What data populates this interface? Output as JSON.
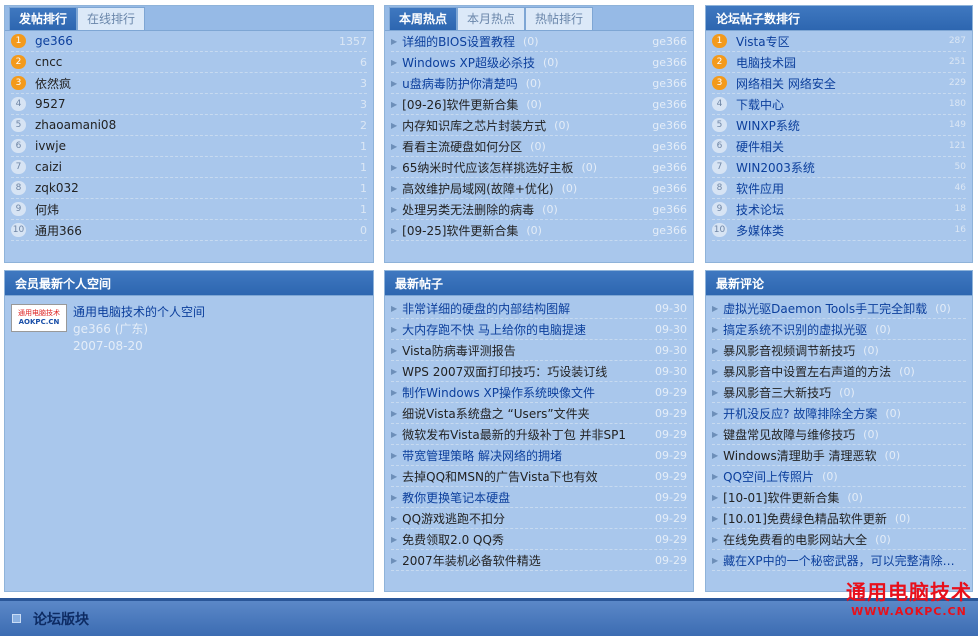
{
  "posts_rank": {
    "tabs": [
      "发帖排行",
      "在线排行"
    ],
    "items": [
      {
        "rank": "1",
        "name": "ge366",
        "count": "1357"
      },
      {
        "rank": "2",
        "name": "cncc",
        "count": "6"
      },
      {
        "rank": "3",
        "name": "依然疯",
        "count": "3"
      },
      {
        "rank": "4",
        "name": "9527",
        "count": "3"
      },
      {
        "rank": "5",
        "name": "zhaoamani08",
        "count": "2"
      },
      {
        "rank": "6",
        "name": "ivwje",
        "count": "1"
      },
      {
        "rank": "7",
        "name": "caizi",
        "count": "1"
      },
      {
        "rank": "8",
        "name": "zqk032",
        "count": "1"
      },
      {
        "rank": "9",
        "name": "何炜",
        "count": "1"
      },
      {
        "rank": "10",
        "name": "通用366",
        "count": "0"
      }
    ]
  },
  "hot_topics": {
    "tabs": [
      "本周热点",
      "本月热点",
      "热帖排行"
    ],
    "items": [
      {
        "title": "详细的BIOS设置教程",
        "count": "(0)",
        "author": "ge366",
        "link": true
      },
      {
        "title": "Windows XP超级必杀技",
        "count": "(0)",
        "author": "ge366",
        "link": true
      },
      {
        "title": "u盘病毒防护你清楚吗",
        "count": "(0)",
        "author": "ge366",
        "link": true
      },
      {
        "title": "[09-26]软件更新合集",
        "count": "(0)",
        "author": "ge366",
        "link": false
      },
      {
        "title": "内存知识库之芯片封装方式",
        "count": "(0)",
        "author": "ge366",
        "link": false
      },
      {
        "title": "看看主流硬盘如何分区",
        "count": "(0)",
        "author": "ge366",
        "link": false
      },
      {
        "title": "65纳米时代应该怎样挑选好主板",
        "count": "(0)",
        "author": "ge366",
        "link": false
      },
      {
        "title": "高效维护局域网(故障+优化)",
        "count": "(0)",
        "author": "ge366",
        "link": false
      },
      {
        "title": "处理另类无法删除的病毒",
        "count": "(0)",
        "author": "ge366",
        "link": false
      },
      {
        "title": "[09-25]软件更新合集",
        "count": "(0)",
        "author": "ge366",
        "link": false
      }
    ]
  },
  "forum_rank": {
    "title": "论坛帖子数排行",
    "items": [
      {
        "rank": "1",
        "name": "Vista专区",
        "count": "287"
      },
      {
        "rank": "2",
        "name": "电脑技术园",
        "count": "251"
      },
      {
        "rank": "3",
        "name": "网络相关 网络安全",
        "count": "229"
      },
      {
        "rank": "4",
        "name": "下载中心",
        "count": "180"
      },
      {
        "rank": "5",
        "name": "WINXP系统",
        "count": "149"
      },
      {
        "rank": "6",
        "name": "硬件相关",
        "count": "121"
      },
      {
        "rank": "7",
        "name": "WIN2003系统",
        "count": "50"
      },
      {
        "rank": "8",
        "name": "软件应用",
        "count": "46"
      },
      {
        "rank": "9",
        "name": "技术论坛",
        "count": "18"
      },
      {
        "rank": "10",
        "name": "多媒体类",
        "count": "16"
      }
    ]
  },
  "member_space": {
    "title": "会员最新个人空间",
    "logo_line1": "通用电脑技术",
    "logo_line2": "AOKPC.CN",
    "space_title": "通用电脑技术的个人空间",
    "owner": "ge366 (广东)",
    "date": "2007-08-20"
  },
  "latest_posts": {
    "title": "最新帖子",
    "items": [
      {
        "title": "非常详细的硬盘的内部结构图解",
        "date": "09-30",
        "link": true
      },
      {
        "title": "大内存跑不快 马上给你的电脑提速",
        "date": "09-30",
        "link": true
      },
      {
        "title": "Vista防病毒评测报告",
        "date": "09-30",
        "link": false
      },
      {
        "title": "WPS 2007双面打印技巧：巧设装订线",
        "date": "09-30",
        "link": false
      },
      {
        "title": "制作Windows XP操作系统映像文件",
        "date": "09-29",
        "link": true
      },
      {
        "title": "细说Vista系统盘之 “Users”文件夹",
        "date": "09-29",
        "link": false
      },
      {
        "title": "微软发布Vista最新的升级补丁包 并非SP1",
        "date": "09-29",
        "link": false
      },
      {
        "title": "带宽管理策略  解决网络的拥堵",
        "date": "09-29",
        "link": true
      },
      {
        "title": "去掉QQ和MSN的广告Vista下也有效",
        "date": "09-29",
        "link": false
      },
      {
        "title": "教你更换笔记本硬盘",
        "date": "09-29",
        "link": true
      },
      {
        "title": "QQ游戏逃跑不扣分",
        "date": "09-29",
        "link": false
      },
      {
        "title": "免费领取2.0 QQ秀",
        "date": "09-29",
        "link": false
      },
      {
        "title": "2007年装机必备软件精选",
        "date": "09-29",
        "link": false
      }
    ]
  },
  "latest_comments": {
    "title": "最新评论",
    "items": [
      {
        "title": "虚拟光驱Daemon Tools手工完全卸载",
        "count": "(0)",
        "link": true
      },
      {
        "title": "搞定系统不识别的虚拟光驱",
        "count": "(0)",
        "link": true
      },
      {
        "title": "暴风影音视频调节新技巧",
        "count": "(0)",
        "link": false
      },
      {
        "title": "暴风影音中设置左右声道的方法",
        "count": "(0)",
        "link": false
      },
      {
        "title": "暴风影音三大新技巧",
        "count": "(0)",
        "link": false
      },
      {
        "title": "开机没反应? 故障排除全方案",
        "count": "(0)",
        "link": true
      },
      {
        "title": "键盘常见故障与维修技巧",
        "count": "(0)",
        "link": false
      },
      {
        "title": "Windows清理助手 清理恶软",
        "count": "(0)",
        "link": false
      },
      {
        "title": "QQ空间上传照片",
        "count": "(0)",
        "link": true
      },
      {
        "title": "[10-01]软件更新合集",
        "count": "(0)",
        "link": false
      },
      {
        "title": "[10.01]免费绿色精品软件更新",
        "count": "(0)",
        "link": false
      },
      {
        "title": "在线免费看的电影网站大全",
        "count": "(0)",
        "link": false
      },
      {
        "title": "藏在XP中的一个秘密武器，可以完整清除垃...",
        "count": "",
        "link": true
      }
    ]
  },
  "bottom": {
    "title": "论坛版块"
  },
  "watermark": {
    "line1": "通用电脑技术",
    "line2": "WWW.AOKPC.CN"
  },
  "colors": {
    "panel_bg": "#a9c7ec",
    "tab_active": "#2d66b0",
    "link": "#0c3f9c",
    "rank_hot": "#f39a1c",
    "watermark": "#e8101b"
  }
}
